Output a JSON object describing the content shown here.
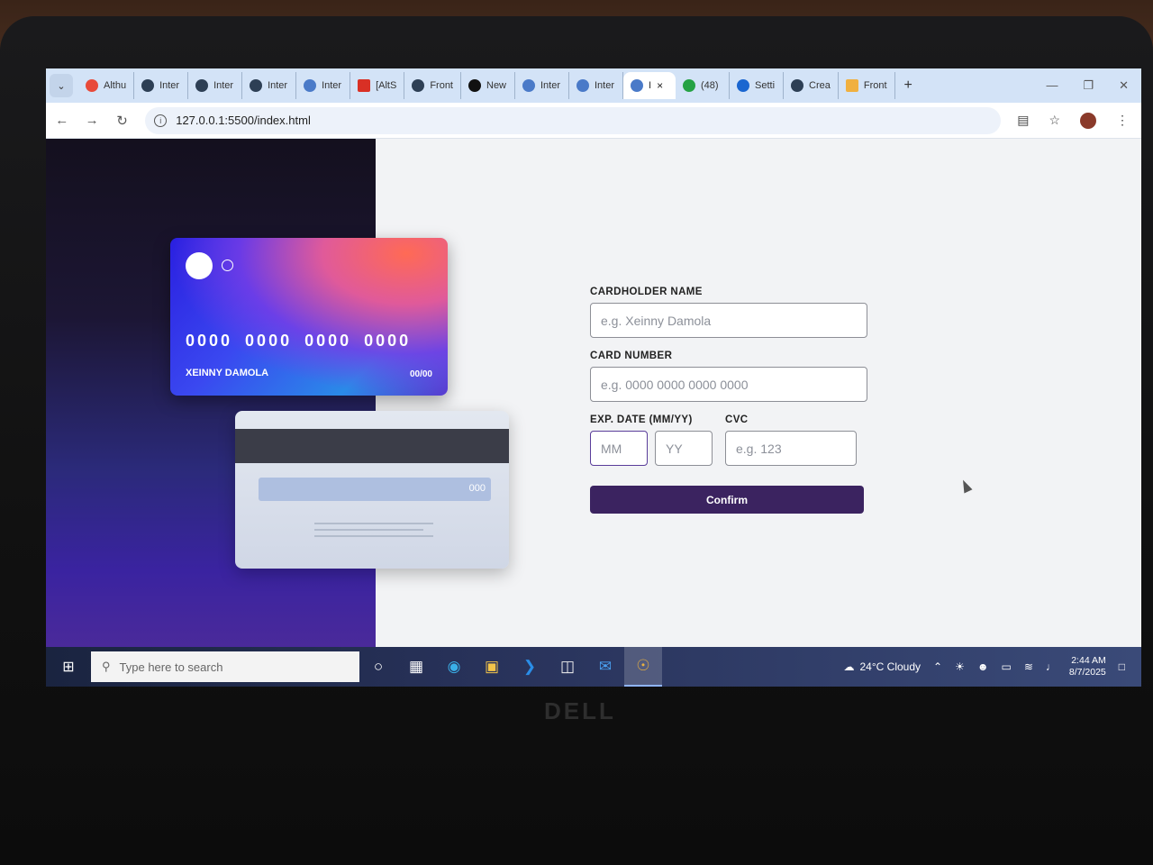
{
  "browser": {
    "tabs": [
      {
        "label": "Althu",
        "icon": "figma-icon"
      },
      {
        "label": "Inter",
        "icon": "globe-icon"
      },
      {
        "label": "Inter",
        "icon": "globe-icon"
      },
      {
        "label": "Inter",
        "icon": "globe-icon"
      },
      {
        "label": "Inter",
        "icon": "globe-icon"
      },
      {
        "label": "[AltS",
        "icon": "gmail-icon"
      },
      {
        "label": "Front",
        "icon": "globe-icon"
      },
      {
        "label": "New",
        "icon": "github-icon"
      },
      {
        "label": "Inter",
        "icon": "globe-icon"
      },
      {
        "label": "Inter",
        "icon": "globe-icon"
      },
      {
        "label": "I",
        "icon": "globe-icon",
        "active": true
      },
      {
        "label": "(48)",
        "icon": "whatsapp-icon"
      },
      {
        "label": "Setti",
        "icon": "gear-icon"
      },
      {
        "label": "Crea",
        "icon": "globe-icon"
      },
      {
        "label": "Front",
        "icon": "globe-icon"
      }
    ],
    "close_glyph": "×",
    "new_tab_glyph": "+",
    "url": "127.0.0.1:5500/index.html"
  },
  "card": {
    "number": "0000 0000 0000 0000",
    "name": "XEINNY DAMOLA",
    "exp": "00/00",
    "cvc": "000"
  },
  "form": {
    "name_label": "CARDHOLDER NAME",
    "name_placeholder": "e.g. Xeinny Damola",
    "number_label": "CARD NUMBER",
    "number_placeholder": "e.g. 0000 0000 0000 0000",
    "exp_label": "EXP. DATE (MM/YY)",
    "mm_placeholder": "MM",
    "yy_placeholder": "YY",
    "cvc_label": "CVC",
    "cvc_placeholder": "e.g. 123",
    "confirm_label": "Confirm"
  },
  "taskbar": {
    "search_placeholder": "Type here to search",
    "weather": "24°C  Cloudy",
    "time": "2:44 AM",
    "date": "8/7/2025"
  },
  "device": {
    "brand": "DELL"
  },
  "colors": {
    "accent": "#3b2360",
    "active_input_border": "#5a3d9a"
  }
}
